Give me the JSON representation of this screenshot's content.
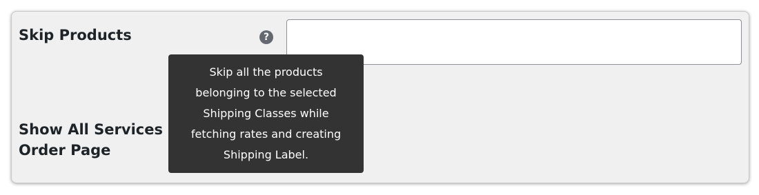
{
  "settings": {
    "skip_products": {
      "label": "Skip Products",
      "help_icon_glyph": "?",
      "input_value": "",
      "input_placeholder": ""
    },
    "show_all_services": {
      "label": "Show All Services in Order Page"
    }
  },
  "tooltip": {
    "lines": [
      "Skip all the products",
      "belonging to the selected",
      "Shipping Classes while",
      "fetching rates and creating",
      "Shipping Label."
    ]
  },
  "colors": {
    "panel_background": "#f0f0f1",
    "tooltip_background": "#333333",
    "help_icon": "#646970",
    "label_text": "#1d2327"
  },
  "icons": {
    "help": "question-circle-icon"
  }
}
